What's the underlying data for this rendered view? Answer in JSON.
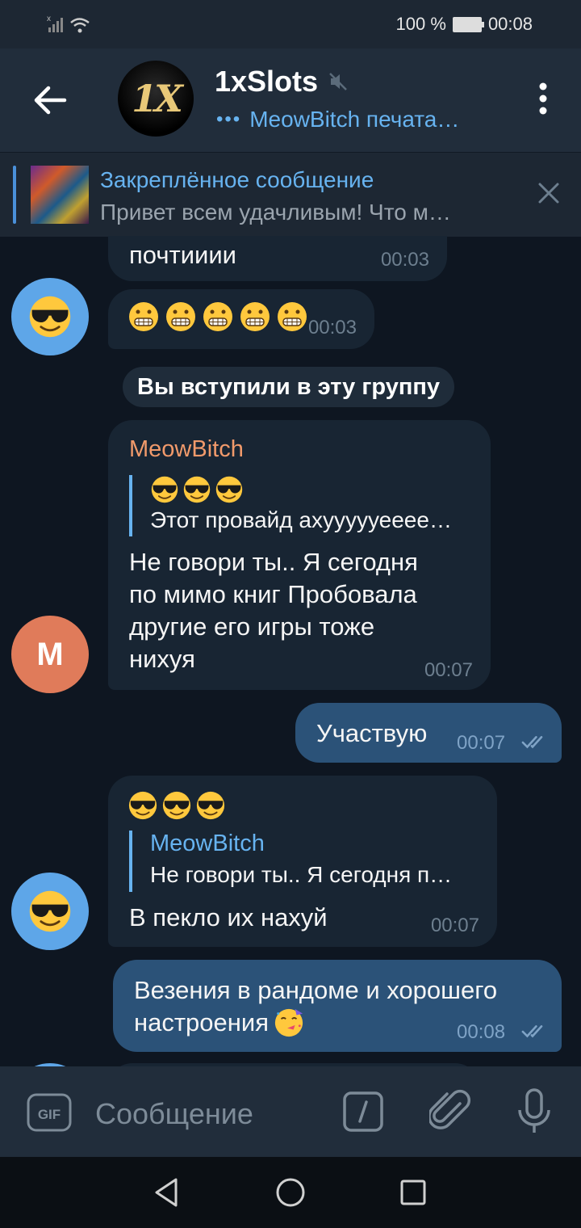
{
  "status": {
    "battery": "100 %",
    "time": "00:08"
  },
  "header": {
    "channel": "1xSlots",
    "typing": "MeowBitch печата…",
    "logo_text": "1X"
  },
  "pinned": {
    "title": "Закреплённое сообщение",
    "text": "Привет всем удачливым! Что м…"
  },
  "messages": {
    "m1": {
      "text": "почтииии",
      "time": "00:03"
    },
    "m2": {
      "time": "00:03"
    },
    "service": "Вы вступили в эту группу",
    "m3": {
      "sender": "MeowBitch",
      "quote_text": "Этот провайд ахуууууееее…",
      "text1": "Не говори ты.. Я сегодня",
      "text2": "по мимо книг Пробовала",
      "text3": "другие его игры тоже",
      "text4": "нихуя",
      "time": "00:07",
      "avatar_letter": "M"
    },
    "m4": {
      "text": "Участвую",
      "time": "00:07"
    },
    "m5": {
      "quote_name": "MeowBitch",
      "quote_text": "Не говори ты.. Я сегодня п…",
      "text": "В пекло их нахуй",
      "time": "00:07"
    },
    "m6": {
      "text1": "Везения в рандоме и хорошего",
      "text2": "настроения",
      "time": "00:08"
    }
  },
  "input": {
    "placeholder": "Сообщение",
    "gif_label": "GIF"
  },
  "colors": {
    "accent": "#67b3f0",
    "bg": "#0e1621",
    "in_bubble": "#182533",
    "out_bubble": "#2b5278",
    "sender": "#f19a6b"
  }
}
